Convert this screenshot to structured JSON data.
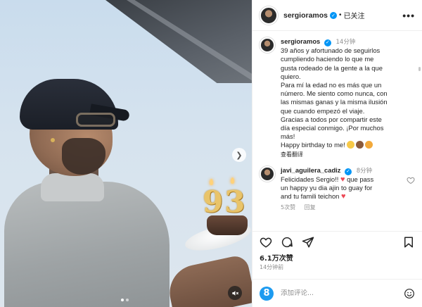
{
  "header": {
    "username": "sergioramos",
    "separator": "•",
    "follow_status": "已关注",
    "more": "•••"
  },
  "caption": {
    "username": "sergioramos",
    "time": "14分钟",
    "lines": [
      "39 años y afortunado de seguirlos",
      "cumpliendo haciendo lo que me",
      "gusta rodeado de la gente a la que",
      "quiero.",
      "Para mí la edad no es más que un",
      "número. Me siento como nunca, con",
      "las mismas ganas y la misma ilusión",
      "que cuando empezó el viaje.",
      "Gracias a todos por compartir este",
      "día especial conmigo. ¡Por muchos",
      "más!",
      "Happy birthday to me! "
    ],
    "see_translation": "查看翻译"
  },
  "comment": {
    "username": "javi_aguilera_cadiz",
    "time": "8分钟",
    "line1_a": "Felicidades Sergio!! ",
    "heart": "♥",
    "line1_b": " que pass",
    "line2": "un happy yu dia ajin to guay for",
    "line3": "and tu famili teichon ",
    "likes_count": "5次赞",
    "reply": "回复"
  },
  "actions": {
    "likes": "6.1万次赞",
    "posted_ago": "14分钟前"
  },
  "add_comment": {
    "placeholder": "添加评论..."
  },
  "media": {
    "candle_digits": "93"
  },
  "colors": {
    "verified_blue": "#0095f6",
    "heart_red": "#ed4956",
    "muted_gray": "#8e8e8e"
  }
}
